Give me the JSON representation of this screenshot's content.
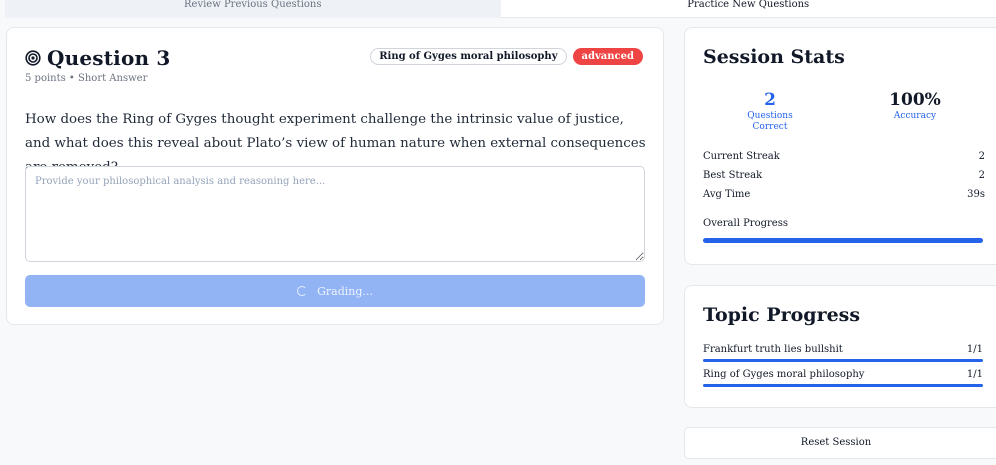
{
  "tabs": {
    "review_label": "Review Previous Questions",
    "practice_label": "Practice New Questions"
  },
  "question": {
    "title": "Question 3",
    "meta": "5 points • Short Answer",
    "topic_badge": "Ring of Gyges moral philosophy",
    "level_badge": "advanced",
    "prompt": "How does the Ring of Gyges thought experiment challenge the intrinsic value of justice, and what does this reveal about Plato’s view of human nature when external consequences are removed?",
    "answer_placeholder": "Provide your philosophical analysis and reasoning here...",
    "answer_value": "",
    "grade_button_label": "Grading..."
  },
  "session_stats": {
    "title": "Session Stats",
    "questions_correct_value": "2",
    "questions_correct_label": "Questions Correct",
    "accuracy_value": "100%",
    "accuracy_label": "Accuracy",
    "rows": [
      {
        "label": "Current Streak",
        "value": "2"
      },
      {
        "label": "Best Streak",
        "value": "2"
      },
      {
        "label": "Avg Time",
        "value": "39s"
      }
    ],
    "overall_progress_label": "Overall Progress",
    "overall_progress_fraction": 1.0
  },
  "topic_progress": {
    "title": "Topic Progress",
    "topics": [
      {
        "name": "Frankfurt truth lies bullshit",
        "count": "1/1",
        "fraction": 1.0
      },
      {
        "name": "Ring of Gyges moral philosophy",
        "count": "1/1",
        "fraction": 1.0
      }
    ]
  },
  "reset_label": "Reset Session",
  "colors": {
    "accent": "#2563eb",
    "danger": "#ef4444",
    "button_disabled": "#93b4f4"
  }
}
